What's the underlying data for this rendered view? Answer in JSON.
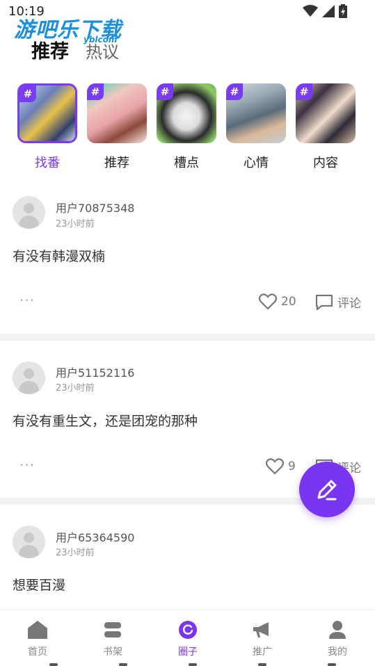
{
  "status_bar": {
    "time": "10:19"
  },
  "watermark": {
    "text": "游吧乐下载",
    "sub": "yblcom"
  },
  "top_tabs": [
    {
      "label": "推荐",
      "active": true
    },
    {
      "label": "热议",
      "active": false
    }
  ],
  "topics": [
    {
      "label": "找番",
      "hash": "#",
      "active": true
    },
    {
      "label": "推荐",
      "hash": "#",
      "active": false
    },
    {
      "label": "槽点",
      "hash": "#",
      "active": false
    },
    {
      "label": "心情",
      "hash": "#",
      "active": false
    },
    {
      "label": "内容",
      "hash": "#",
      "active": false
    }
  ],
  "posts": [
    {
      "user": "用户70875348",
      "time": "23小时前",
      "content": "有没有韩漫双楠",
      "more": "···",
      "likes": "20",
      "comment_label": "评论"
    },
    {
      "user": "用户51152116",
      "time": "23小时前",
      "content": "有没有重生文，还是团宠的那种",
      "more": "···",
      "likes": "9",
      "comment_label": "评论"
    },
    {
      "user": "用户65364590",
      "time": "23小时前",
      "content": "想要百漫"
    }
  ],
  "bottom_nav": [
    {
      "label": "首页",
      "icon": "home-icon",
      "active": false
    },
    {
      "label": "书架",
      "icon": "bookshelf-icon",
      "active": false
    },
    {
      "label": "圈子",
      "icon": "circle-icon",
      "active": true
    },
    {
      "label": "推广",
      "icon": "megaphone-icon",
      "active": false
    },
    {
      "label": "我的",
      "icon": "profile-icon",
      "active": false
    }
  ],
  "colors": {
    "accent": "#7a35f0",
    "text": "#333333",
    "muted": "#999999"
  }
}
